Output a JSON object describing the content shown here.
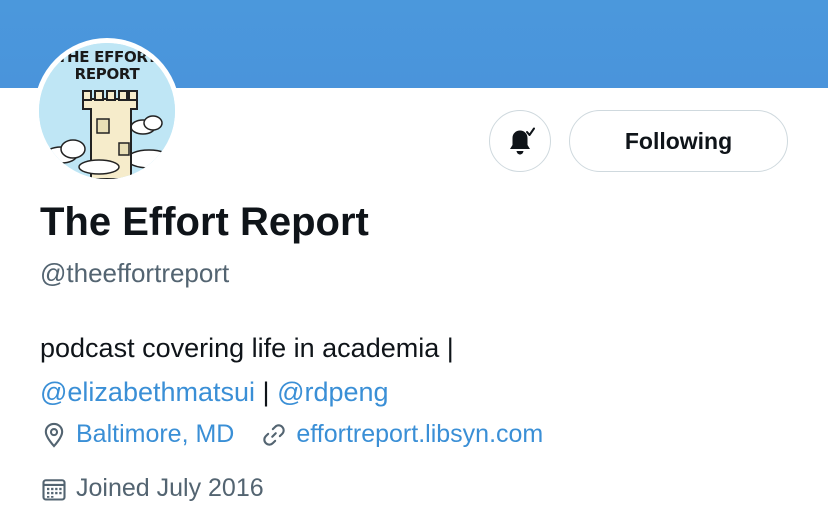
{
  "profile": {
    "avatar_logo_line1": "THE EFFORT",
    "avatar_logo_line2": "REPORT",
    "name": "The Effort Report",
    "handle": "@theeffortreport",
    "bio_text": "podcast covering life in academia |",
    "bio_mention_1": "@elizabethmatsui",
    "bio_separator": "|",
    "bio_mention_2": "@rdpeng",
    "location": "Baltimore, MD",
    "website": "effortreport.libsyn.com",
    "joined": "Joined July 2016"
  },
  "actions": {
    "notify_icon": "bell-check-icon",
    "follow_label": "Following"
  },
  "colors": {
    "banner": "#4a94db",
    "link": "#3a8fd6",
    "secondary_text": "#536471",
    "border": "#cfd9de"
  }
}
